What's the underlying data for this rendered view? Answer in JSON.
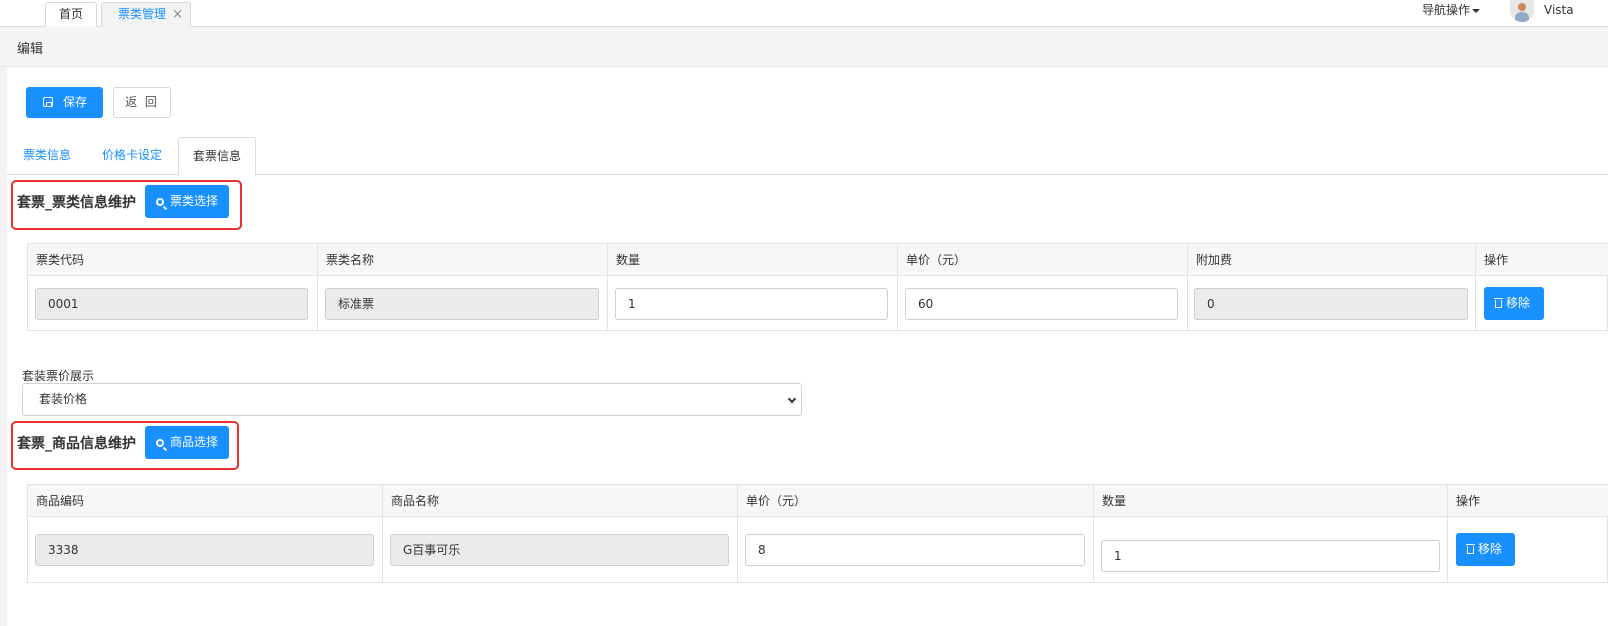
{
  "topbar": {
    "tabs": [
      {
        "label": "首页"
      },
      {
        "label": "票类管理",
        "close": "×"
      }
    ],
    "nav_ops": "导航操作",
    "username": "Vista"
  },
  "page": {
    "title": "编辑",
    "save_label": "保存",
    "back_label": "返 回"
  },
  "subtabs": [
    "票类信息",
    "价格卡设定",
    "套票信息"
  ],
  "ticket_section": {
    "title": "套票_票类信息维护",
    "select_button": "票类选择",
    "columns": [
      "票类代码",
      "票类名称",
      "数量",
      "单价（元）",
      "附加费",
      "操作"
    ],
    "rows": [
      {
        "code": "0001",
        "name": "标准票",
        "qty": "1",
        "price": "60",
        "surcharge": "0",
        "action": "移除"
      }
    ]
  },
  "display": {
    "label": "套装票价展示",
    "selected": "套装价格"
  },
  "goods_section": {
    "title": "套票_商品信息维护",
    "select_button": "商品选择",
    "columns": [
      "商品编码",
      "商品名称",
      "单价（元）",
      "数量",
      "操作"
    ],
    "rows": [
      {
        "code": "3338",
        "name": "G百事可乐",
        "price": "8",
        "qty": "1",
        "action": "移除"
      }
    ]
  },
  "colors": {
    "primary": "#1890ff",
    "highlight": "#e8312f"
  }
}
